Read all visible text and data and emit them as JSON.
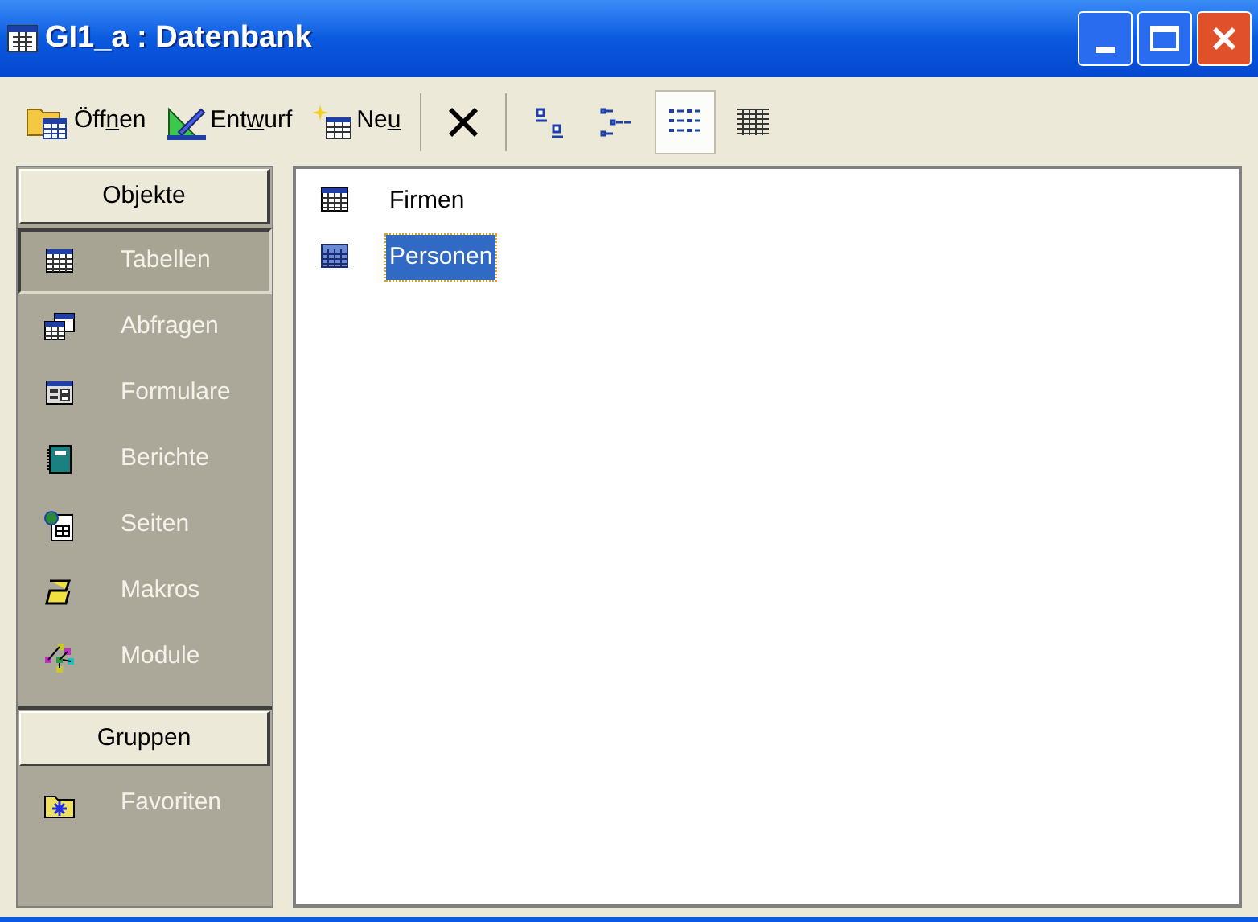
{
  "window": {
    "title": "GI1_a : Datenbank"
  },
  "toolbar": {
    "commands": [
      {
        "kind": "open",
        "before": "Öff",
        "key": "n",
        "after": "en"
      },
      {
        "kind": "design",
        "before": "Ent",
        "key": "w",
        "after": "urf"
      },
      {
        "kind": "new",
        "before": "Ne",
        "key": "u"
      }
    ],
    "views": [
      {
        "kind": "large",
        "selected": false
      },
      {
        "kind": "small",
        "selected": false
      },
      {
        "kind": "list",
        "selected": true
      },
      {
        "kind": "details",
        "selected": false
      }
    ]
  },
  "sidebar": {
    "sections": [
      {
        "label": "Objekte",
        "items": [
          {
            "kind": "table",
            "label": "Tabellen",
            "selected": true
          },
          {
            "kind": "query",
            "label": "Abfragen",
            "selected": false
          },
          {
            "kind": "form",
            "label": "Formulare",
            "selected": false
          },
          {
            "kind": "report",
            "label": "Berichte",
            "selected": false
          },
          {
            "kind": "page",
            "label": "Seiten",
            "selected": false
          },
          {
            "kind": "macro",
            "label": "Makros",
            "selected": false
          },
          {
            "kind": "module",
            "label": "Module",
            "selected": false
          }
        ]
      },
      {
        "label": "Gruppen",
        "items": [
          {
            "kind": "favorites",
            "label": "Favoriten",
            "selected": false
          }
        ]
      }
    ]
  },
  "objects": [
    {
      "label": "Firmen",
      "selected": false
    },
    {
      "label": "Personen",
      "selected": true
    }
  ]
}
